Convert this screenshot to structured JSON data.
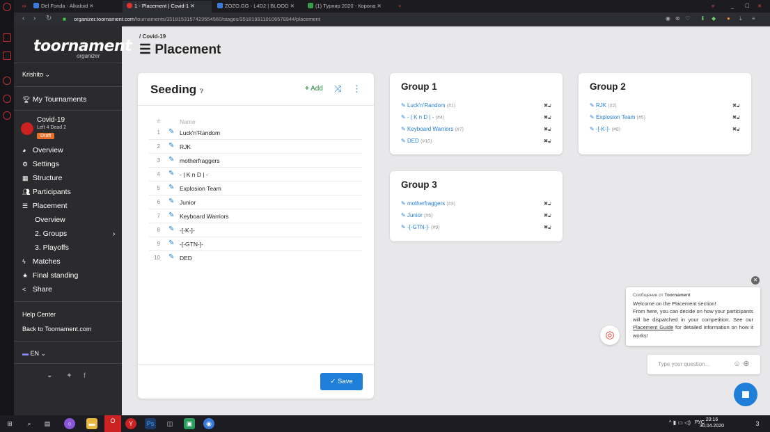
{
  "browser": {
    "tabs": [
      {
        "label": "Del Fonda - Alkaloid",
        "color": "#c44"
      },
      {
        "label": "1 - Placement | Covid-1",
        "color": "#d33"
      },
      {
        "label": "ZOZO.GG - L4D2 | BLOOD",
        "color": "#3a7ad9"
      },
      {
        "label": "(1) Турнир 2020 - Корона",
        "color": "#3a9b4a"
      }
    ],
    "new_tab": "+",
    "url_domain": "organizer.toornament.com",
    "url_path": "/tournaments/3518153157423554560/stages/3518199110106578944/placement"
  },
  "sidebar": {
    "logo_main": "toornament",
    "logo_sub": "organizer",
    "user": "Krishito",
    "my_tournaments": "My Tournaments",
    "tournament_name": "Covid-19",
    "tournament_sub": "Left 4 Dead 2",
    "tournament_badge": "Draft",
    "menu": [
      {
        "label": "Overview",
        "icon": "gauge-icon"
      },
      {
        "label": "Settings",
        "icon": "gears-icon"
      },
      {
        "label": "Structure",
        "icon": "grid-icon"
      },
      {
        "label": "Participants",
        "icon": "users-icon"
      },
      {
        "label": "Placement",
        "icon": "list-ordered-icon"
      }
    ],
    "placement_sub": [
      "Overview",
      "2. Groups",
      "3. Playoffs"
    ],
    "menu2": [
      {
        "label": "Matches",
        "icon": "bolt-icon"
      },
      {
        "label": "Final standing",
        "icon": "star-icon"
      },
      {
        "label": "Share",
        "icon": "share-icon"
      }
    ],
    "help": "Help Center",
    "back": "Back to Toornament.com",
    "lang": "EN"
  },
  "page": {
    "breadcrumb": "/ Covid-19",
    "title": "Placement"
  },
  "seeding": {
    "title": "Seeding",
    "add_label": "Add",
    "col_num": "#",
    "col_name": "Name",
    "rows": [
      {
        "num": "1",
        "name": "Luck'n'Random"
      },
      {
        "num": "2",
        "name": "RJK"
      },
      {
        "num": "3",
        "name": "motherfraggers"
      },
      {
        "num": "4",
        "name": "- | K n D | -"
      },
      {
        "num": "5",
        "name": "Explosion Team"
      },
      {
        "num": "6",
        "name": "Junior"
      },
      {
        "num": "7",
        "name": "Keyboard Warriors"
      },
      {
        "num": "8",
        "name": "-[-K-]-"
      },
      {
        "num": "9",
        "name": "-[-GTN-]-"
      },
      {
        "num": "10",
        "name": "DED"
      }
    ],
    "save_label": "Save"
  },
  "groups": [
    {
      "title": "Group 1",
      "entries": [
        {
          "name": "Luck'n'Random",
          "seed": "(#1)"
        },
        {
          "name": "- | K n D | -",
          "seed": "(#4)"
        },
        {
          "name": "Keyboard Warriors",
          "seed": "(#7)"
        },
        {
          "name": "DED",
          "seed": "(#10)"
        }
      ]
    },
    {
      "title": "Group 2",
      "entries": [
        {
          "name": "RJK",
          "seed": "(#2)"
        },
        {
          "name": "Explosion Team",
          "seed": "(#5)"
        },
        {
          "name": "-[-K-]-",
          "seed": "(#8)"
        }
      ]
    },
    {
      "title": "Group 3",
      "entries": [
        {
          "name": "motherfraggers",
          "seed": "(#3)"
        },
        {
          "name": "Junior",
          "seed": "(#6)"
        },
        {
          "name": "-[-GTN-]-",
          "seed": "(#9)"
        }
      ]
    }
  ],
  "chat": {
    "from_prefix": "Сообщение от",
    "from_name": "Toornament",
    "line1": "Welcome on the Placement section!",
    "line2": "From here, you can decide on how your participants will be dispatched in your competition. See our",
    "link": "Placement Guide",
    "line3": "for detailed information on how it works!",
    "input_placeholder": "Type your question..."
  },
  "taskbar": {
    "lang": "РУС",
    "time": "20:16",
    "date": "30.04.2020",
    "notif_count": "3"
  }
}
